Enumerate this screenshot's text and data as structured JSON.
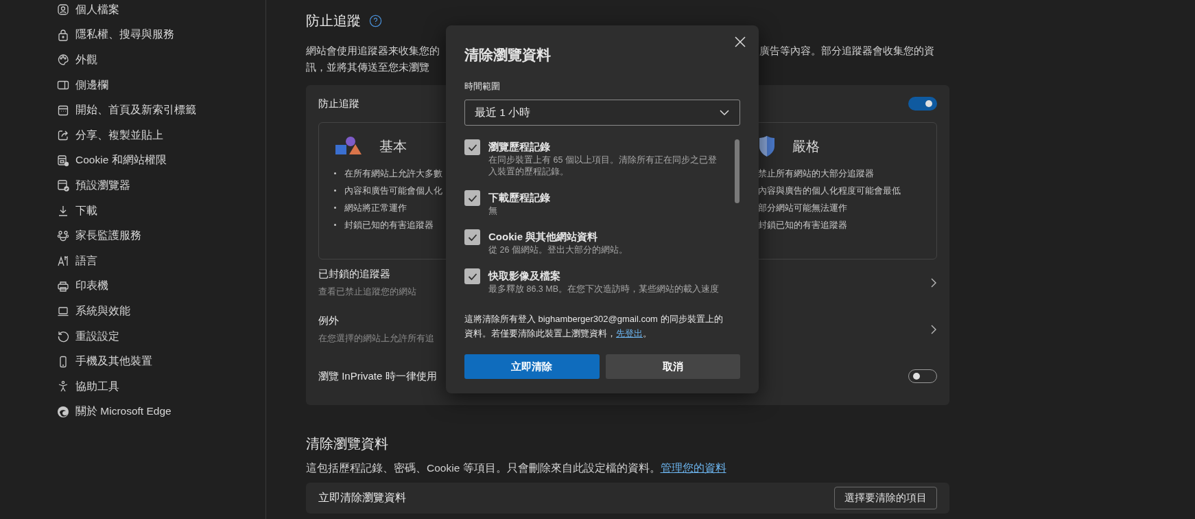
{
  "sidebar": {
    "items": [
      {
        "label": "個人檔案"
      },
      {
        "label": "隱私權、搜尋與服務"
      },
      {
        "label": "外觀"
      },
      {
        "label": "側邊欄"
      },
      {
        "label": "開始、首頁及新索引標籤"
      },
      {
        "label": "分享、複製並貼上"
      },
      {
        "label": "Cookie 和網站權限"
      },
      {
        "label": "預設瀏覽器"
      },
      {
        "label": "下載"
      },
      {
        "label": "家長監護服務"
      },
      {
        "label": "語言"
      },
      {
        "label": "印表機"
      },
      {
        "label": "系統與效能"
      },
      {
        "label": "重設設定"
      },
      {
        "label": "手機及其他裝置"
      },
      {
        "label": "協助工具"
      },
      {
        "label": "關於 Microsoft Edge"
      }
    ]
  },
  "tracking": {
    "title": "防止追蹤",
    "description": [
      {
        "left": "網站會使用追蹤器来收集您的",
        "right": "廣告等內容。部分追蹤器會收集您的資"
      },
      {
        "left": "訊，並將其傳送至您未瀏覽"
      }
    ],
    "card": {
      "header": "防止追蹤",
      "on": true,
      "levels": [
        {
          "kind": "basic",
          "title": "基本",
          "bullets": [
            "在所有網站上允許大多數",
            "內容和廣告可能會個人化",
            "網站將正常運作",
            "封鎖已知的有害追蹤器"
          ]
        },
        {
          "kind": "strict",
          "title": "嚴格",
          "bullets": [
            "禁止所有網站的大部分追蹤器",
            "內容與廣告的個人化程度可能會最低",
            "部分網站可能無法運作",
            "封鎖已知的有害追蹤器"
          ]
        }
      ],
      "rows": [
        {
          "kind": "link",
          "title": "已封鎖的追蹤器",
          "subtitle": "查看已禁止追蹤您的網站"
        },
        {
          "kind": "link",
          "title": "例外",
          "subtitle": "在您選擇的網站上允許所有追"
        },
        {
          "kind": "toggle",
          "title": "瀏覽 InPrivate 時一律使用",
          "on": false
        }
      ]
    }
  },
  "clear_section": {
    "title": "清除瀏覽資料",
    "description": "這包括歷程記錄、密碼、Cookie 等項目。只會刪除來自此設定檔的資料。",
    "link": "管理您的資料",
    "row_title": "立即清除瀏覽資料",
    "row_button": "選擇要清除的項目"
  },
  "dialog": {
    "title": "清除瀏覽資料",
    "range_label": "時間範圍",
    "range_value": "最近 1 小時",
    "items": [
      {
        "title": "瀏覽歷程記錄",
        "detail": "在同步裝置上有 65 個以上項目。清除所有正在同步之已登入裝置的歷程記錄。",
        "checked": true
      },
      {
        "title": "下載歷程記錄",
        "detail": "無",
        "checked": true
      },
      {
        "title": "Cookie 與其他網站資料",
        "detail": "從 26 個網站。登出大部分的網站。",
        "checked": true
      },
      {
        "title": "快取影像及檔案",
        "detail": "最多釋放 86.3 MB。在您下次造訪時，某些網站的載入速度",
        "checked": true
      }
    ],
    "notice": "這將清除所有登入 bighamberger302@gmail.com 的同步裝置上的資料。若僅要清除此裝置上瀏覽資料，",
    "notice_link": "先登出",
    "notice_end": "。",
    "buttons": [
      {
        "kind": "primary",
        "label": "立即清除"
      },
      {
        "kind": "secondary",
        "label": "取消"
      }
    ]
  }
}
